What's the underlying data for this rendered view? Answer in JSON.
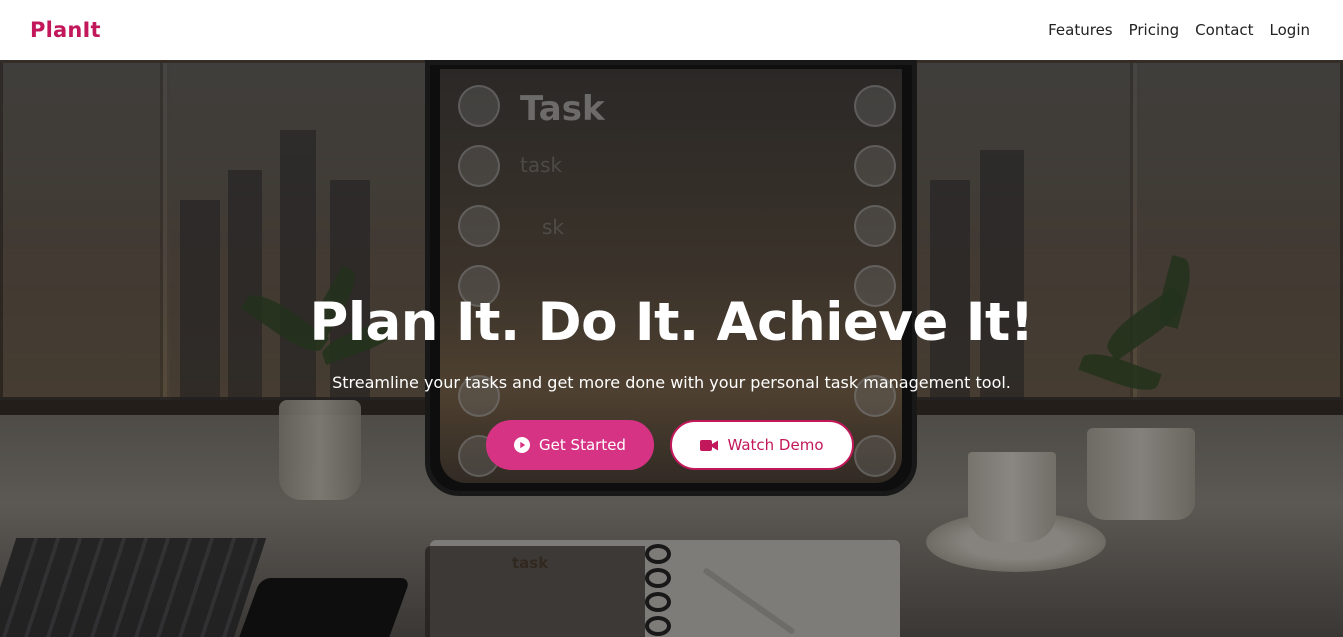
{
  "nav": {
    "brand": "PlanIt",
    "links": [
      {
        "label": "Features"
      },
      {
        "label": "Pricing"
      },
      {
        "label": "Contact"
      },
      {
        "label": "Login"
      }
    ]
  },
  "hero": {
    "title": "Plan It. Do It. Achieve It!",
    "subtitle": "Streamline your tasks and get more done with your personal task management tool.",
    "primary_button": {
      "label": "Get Started",
      "icon": "play-circle-icon"
    },
    "secondary_button": {
      "label": "Watch Demo",
      "icon": "video-camera-icon"
    }
  },
  "background_image": {
    "tablet_title": "Task",
    "ghost_lines": [
      "task",
      "sk"
    ],
    "notebook_label": "task"
  },
  "colors": {
    "brand": "#c2185b",
    "primary_button": "#d63384",
    "nav_background": "#ffffff",
    "hero_overlay": "rgba(0,0,0,0.45)"
  }
}
